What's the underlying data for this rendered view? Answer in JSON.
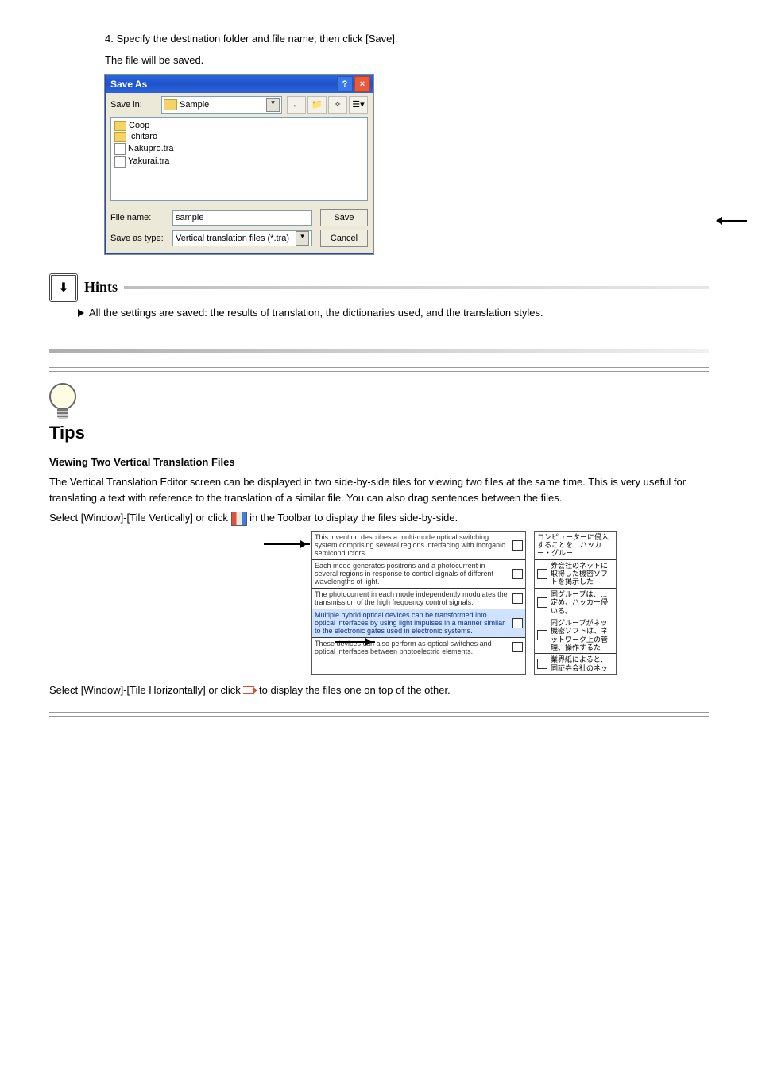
{
  "intro1": "4. Specify the destination folder and file name, then click [Save].",
  "intro2": "The file will be saved.",
  "dialog": {
    "title": "Save As",
    "save_in_label": "Save in:",
    "save_in_value": "Sample",
    "files": [
      "Coop",
      "Ichitaro",
      "Nakupro.tra",
      "Yakurai.tra"
    ],
    "file_name_label": "File name:",
    "file_name_value": "sample",
    "save_type_label": "Save as type:",
    "save_type_value": "Vertical translation files (*.tra)",
    "save_btn": "Save",
    "cancel_btn": "Cancel"
  },
  "hints": {
    "label": "Hints",
    "text": "All the settings are saved: the results of translation, the dictionaries used, and the translation styles."
  },
  "tips": {
    "label": "Tips",
    "heading": "Viewing Two Vertical Translation Files",
    "body1": "The Vertical Translation Editor screen can be displayed in two side-by-side tiles for viewing two files at the same time. This is very useful for translating a text with reference to the translation of a similar file. You can also drag sentences between the files.",
    "body2_a": "Select [Window]-[Tile Vertically] or click ",
    "body2_b": " in the Toolbar to display the files side-by-side.",
    "left_cells": [
      {
        "txt": "This invention describes a multi-mode optical switching system comprising several regions interfacing with inorganic semiconductors.",
        "sel": false
      },
      {
        "txt": "Each mode generates positrons and a photocurrent in several regions in response to control signals of different wavelengths of light.",
        "sel": false
      },
      {
        "txt": "The photocurrent in each mode independently modulates the transmission of the high frequency control signals.",
        "sel": false
      },
      {
        "txt": "Multiple hybrid optical devices can be transformed into optical interfaces by using light impulses in a manner similar to the electronic gates used in electronic systems.",
        "sel": true
      },
      {
        "txt": "These devices can also perform as optical switches and optical interfaces between photoelectric elements.",
        "sel": false
      }
    ],
    "right_cells": [
      "コンピューターに侵入することを…ハッカー・グルー…",
      "券会社のネットに取得した機密ソフトを掲示した",
      "同グループは、…定め、ハッカー侵いる。",
      "同グループがネッ機密ソフトは、ネットワーク上の管理、操作するた",
      "業界紙によると、同証券会社のネッ"
    ],
    "footer_a": "Select [Window]-[Tile Horizontally] or click ",
    "footer_b": " to display the files one on top of the other."
  }
}
